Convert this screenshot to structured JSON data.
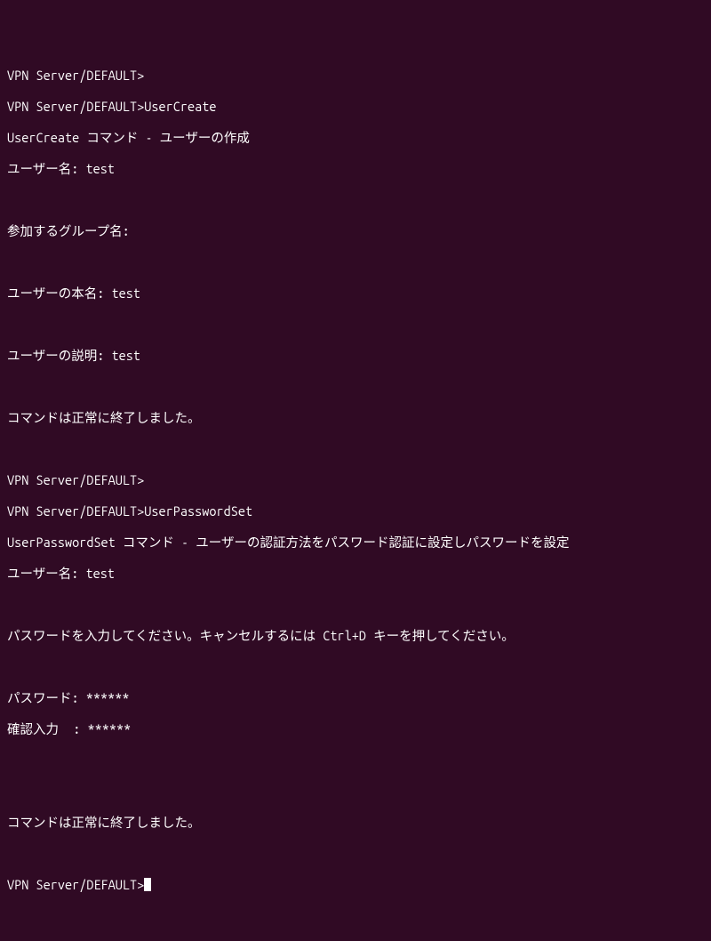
{
  "terminal": {
    "lines": [
      {
        "prompt": "VPN Server/DEFAULT>",
        "input": ""
      },
      {
        "prompt": "VPN Server/DEFAULT>",
        "input": "UserCreate"
      },
      {
        "text": "UserCreate コマンド - ユーザーの作成"
      },
      {
        "text": "ユーザー名: test"
      },
      {
        "text": ""
      },
      {
        "text": "参加するグループ名:"
      },
      {
        "text": ""
      },
      {
        "text": "ユーザーの本名: test"
      },
      {
        "text": ""
      },
      {
        "text": "ユーザーの説明: test"
      },
      {
        "text": ""
      },
      {
        "text": "コマンドは正常に終了しました。"
      },
      {
        "text": ""
      },
      {
        "prompt": "VPN Server/DEFAULT>",
        "input": ""
      },
      {
        "prompt": "VPN Server/DEFAULT>",
        "input": "UserPasswordSet"
      },
      {
        "text": "UserPasswordSet コマンド - ユーザーの認証方法をパスワード認証に設定しパスワードを設定"
      },
      {
        "text": "ユーザー名: test"
      },
      {
        "text": ""
      },
      {
        "text": "パスワードを入力してください。キャンセルするには Ctrl+D キーを押してください。"
      },
      {
        "text": ""
      },
      {
        "text": "パスワード: ******"
      },
      {
        "text": "確認入力  : ******"
      },
      {
        "text": ""
      },
      {
        "text": ""
      },
      {
        "text": "コマンドは正常に終了しました。"
      },
      {
        "text": ""
      }
    ],
    "final_prompt": "VPN Server/DEFAULT>"
  }
}
